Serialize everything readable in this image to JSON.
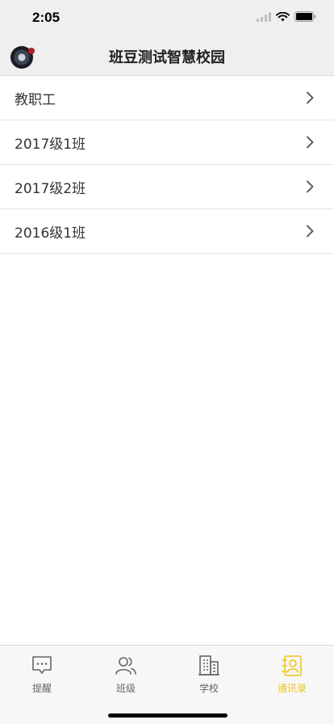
{
  "status_bar": {
    "time": "2:05"
  },
  "nav": {
    "title": "班豆测试智慧校园"
  },
  "list": {
    "items": [
      {
        "label": "教职工"
      },
      {
        "label": "2017级1班"
      },
      {
        "label": "2017级2班"
      },
      {
        "label": "2016级1班"
      }
    ]
  },
  "tab_bar": {
    "tabs": [
      {
        "label": "提醒",
        "icon": "chat-bubble-icon"
      },
      {
        "label": "班级",
        "icon": "people-icon"
      },
      {
        "label": "学校",
        "icon": "building-icon"
      },
      {
        "label": "通讯录",
        "icon": "contacts-icon",
        "active": true
      }
    ],
    "active_color": "#f0c419"
  }
}
